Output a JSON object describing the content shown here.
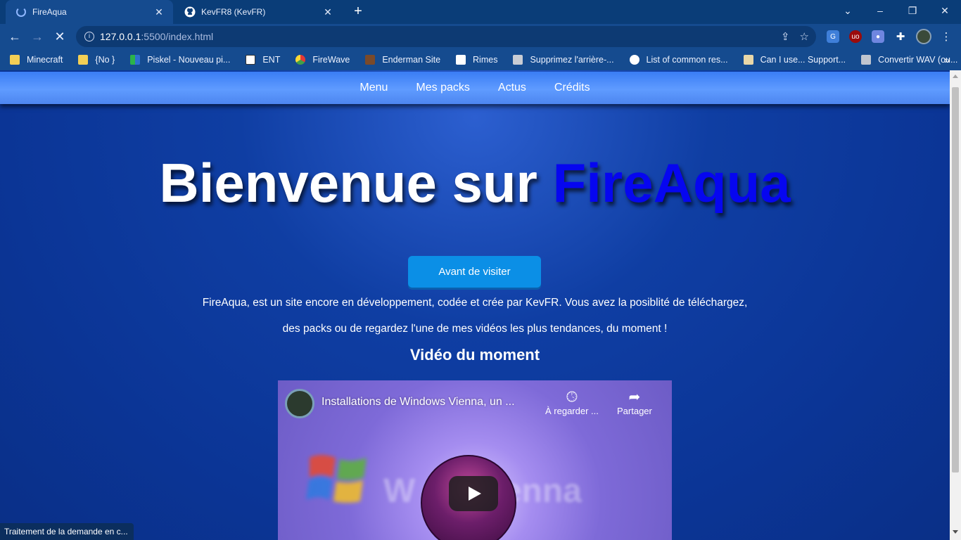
{
  "tabs": [
    {
      "title": "FireAqua",
      "active": true,
      "icon": "loading-spinner-icon"
    },
    {
      "title": "KevFR8 (KevFR)",
      "active": false,
      "icon": "github-icon"
    }
  ],
  "address": {
    "host": "127.0.0.1",
    "path": ":5500/index.html"
  },
  "bookmarks": [
    {
      "label": "Minecraft",
      "icon": "folder-icon"
    },
    {
      "label": "{No }",
      "icon": "folder-icon"
    },
    {
      "label": "Piskel - Nouveau pi...",
      "icon": "piskel-icon"
    },
    {
      "label": "ENT",
      "icon": "ent-icon"
    },
    {
      "label": "FireWave",
      "icon": "firewave-icon"
    },
    {
      "label": "Enderman Site",
      "icon": "enderman-icon"
    },
    {
      "label": "Rimes",
      "icon": "rimes-icon"
    },
    {
      "label": "Supprimez l'arrière-...",
      "icon": "remove-bg-icon"
    },
    {
      "label": "List of common res...",
      "icon": "wikipedia-icon"
    },
    {
      "label": "Can I use... Support...",
      "icon": "caniuse-icon"
    },
    {
      "label": "Convertir WAV (ou...",
      "icon": "convert-icon"
    }
  ],
  "site": {
    "nav": [
      "Menu",
      "Mes packs",
      "Actus",
      "Crédits"
    ],
    "hero_prefix": "Bienvenue sur ",
    "hero_accent": "FireAqua",
    "cta_label": "Avant de visiter",
    "intro_line1": "FireAqua, est un site encore en développement, codée et crée par KevFR. Vous avez la posiblité de téléchargez,",
    "intro_line2": "des packs ou de regardez l'une de mes vidéos les plus tendances, du moment !",
    "video_section_title": "Vidéo du moment"
  },
  "video": {
    "title": "Installations de Windows Vienna, un ...",
    "watch_later": "À regarder ...",
    "share": "Partager"
  },
  "status_text": "Traitement de la demande en c..."
}
